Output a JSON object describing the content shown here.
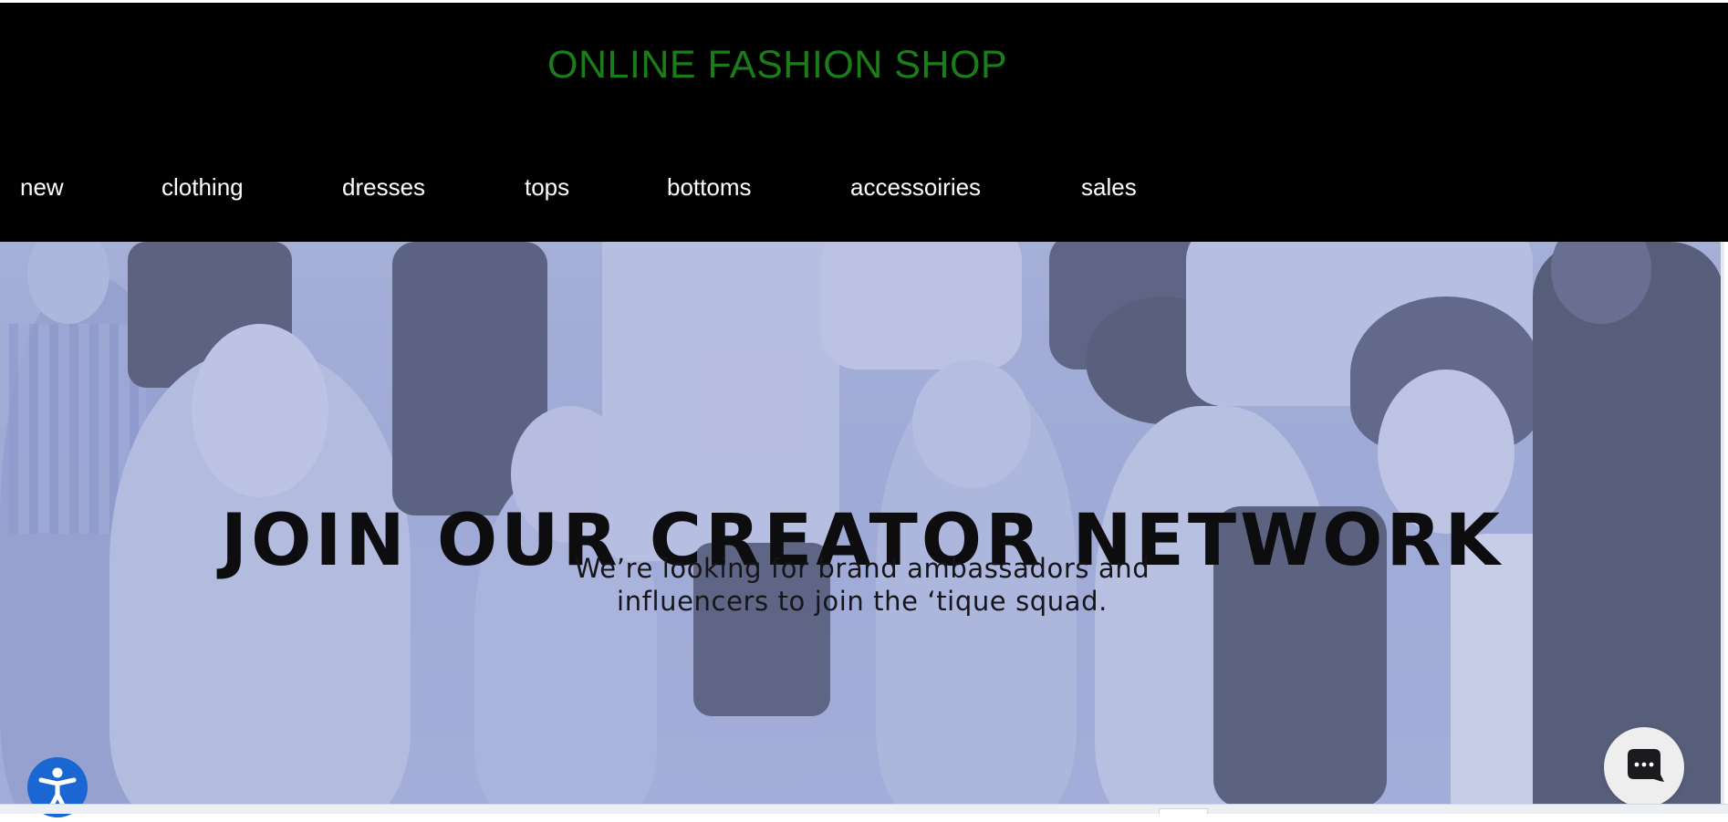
{
  "header": {
    "shop_title": "ONLINE FASHION SHOP",
    "nav": [
      {
        "label": "new"
      },
      {
        "label": "clothing"
      },
      {
        "label": "dresses"
      },
      {
        "label": "tops"
      },
      {
        "label": "bottoms"
      },
      {
        "label": "accessoiries"
      },
      {
        "label": "sales"
      }
    ]
  },
  "hero": {
    "title": "JOIN OUR CREATOR NETWORK",
    "subtitle_line1": "We’re looking for brand ambassadors and",
    "subtitle_line2": "influencers to join the ‘tique squad."
  },
  "widgets": {
    "accessibility_icon": "accessibility-person-icon",
    "chat_icon": "chat-bubble-icon"
  },
  "colors": {
    "header_bg": "#000000",
    "title_green": "#1a7d1a",
    "hero_tint": "#a4aed8",
    "accessibility_blue": "#1a66d2"
  }
}
